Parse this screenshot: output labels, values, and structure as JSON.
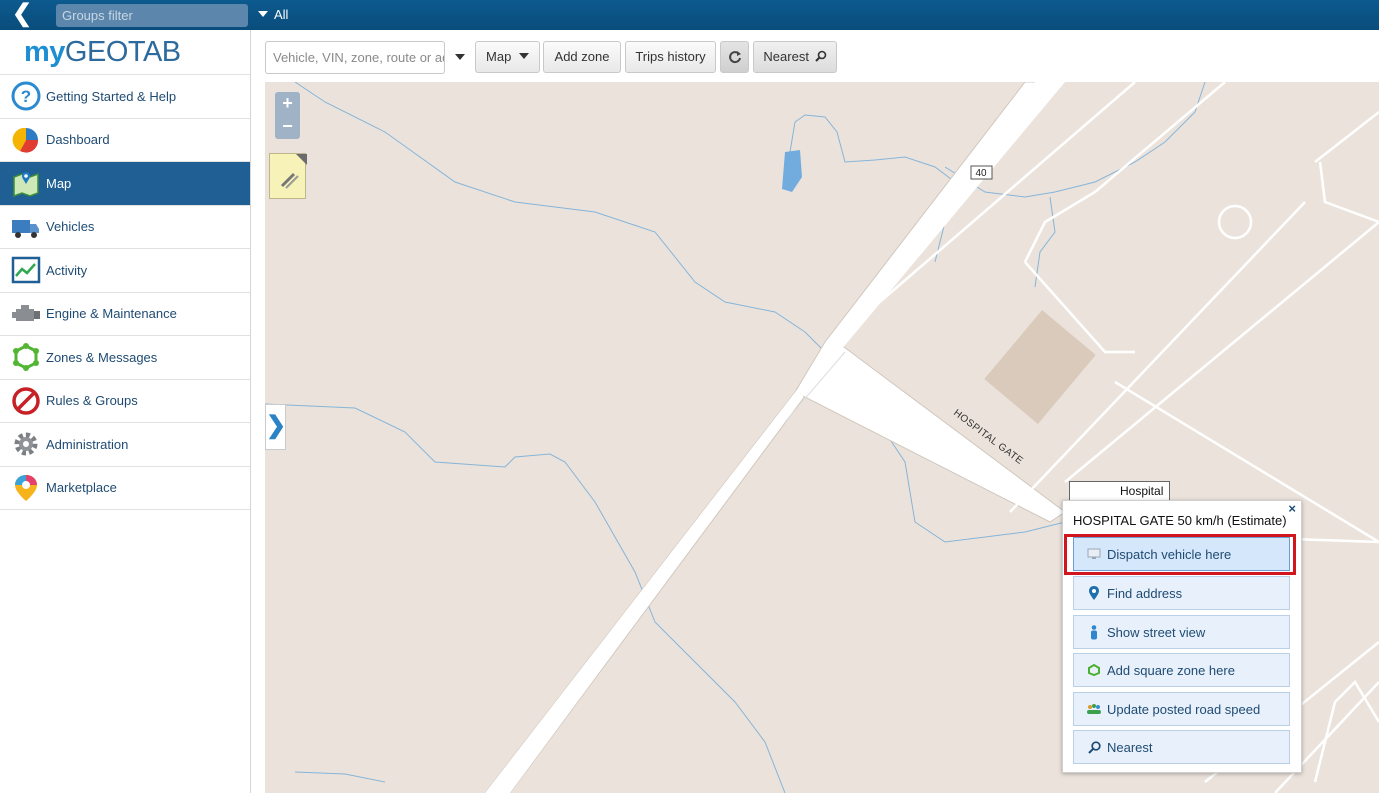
{
  "topbar": {
    "groups_filter_placeholder": "Groups filter",
    "all_label": "All"
  },
  "sidebar": {
    "logo_my": "my",
    "logo_geotab": "GEOTAB",
    "items": [
      {
        "label": "Getting Started & Help",
        "icon": "help-icon"
      },
      {
        "label": "Dashboard",
        "icon": "pie-chart-icon"
      },
      {
        "label": "Map",
        "icon": "map-icon",
        "active": true
      },
      {
        "label": "Vehicles",
        "icon": "truck-icon"
      },
      {
        "label": "Activity",
        "icon": "activity-chart-icon"
      },
      {
        "label": "Engine & Maintenance",
        "icon": "engine-icon"
      },
      {
        "label": "Zones & Messages",
        "icon": "zone-icon"
      },
      {
        "label": "Rules & Groups",
        "icon": "prohibited-icon"
      },
      {
        "label": "Administration",
        "icon": "gear-icon"
      },
      {
        "label": "Marketplace",
        "icon": "marketplace-pin-icon"
      }
    ]
  },
  "toolbar": {
    "search_placeholder": "Vehicle, VIN, zone, route or address",
    "map_label": "Map",
    "add_zone_label": "Add zone",
    "trips_history_label": "Trips history",
    "nearest_label": "Nearest"
  },
  "map": {
    "road_shield": "40",
    "street_label": "HOSPITAL GATE",
    "marker_label": "Hospital",
    "popup": {
      "title": "HOSPITAL GATE 50 km/h (Estimate)",
      "close": "×",
      "actions": [
        {
          "label": "Dispatch vehicle here",
          "icon": "dispatch-monitor-icon"
        },
        {
          "label": "Find address",
          "icon": "location-pin-icon"
        },
        {
          "label": "Show street view",
          "icon": "street-view-person-icon"
        },
        {
          "label": "Add square zone here",
          "icon": "zone-add-icon"
        },
        {
          "label": "Update posted road speed",
          "icon": "road-speed-icon"
        },
        {
          "label": "Nearest",
          "icon": "magnifier-icon"
        }
      ]
    }
  },
  "colors": {
    "topbar": "#0c5a8f",
    "active_nav": "#1f5f93",
    "map_bg": "#ebe3db",
    "highlight": "#d2161e"
  }
}
